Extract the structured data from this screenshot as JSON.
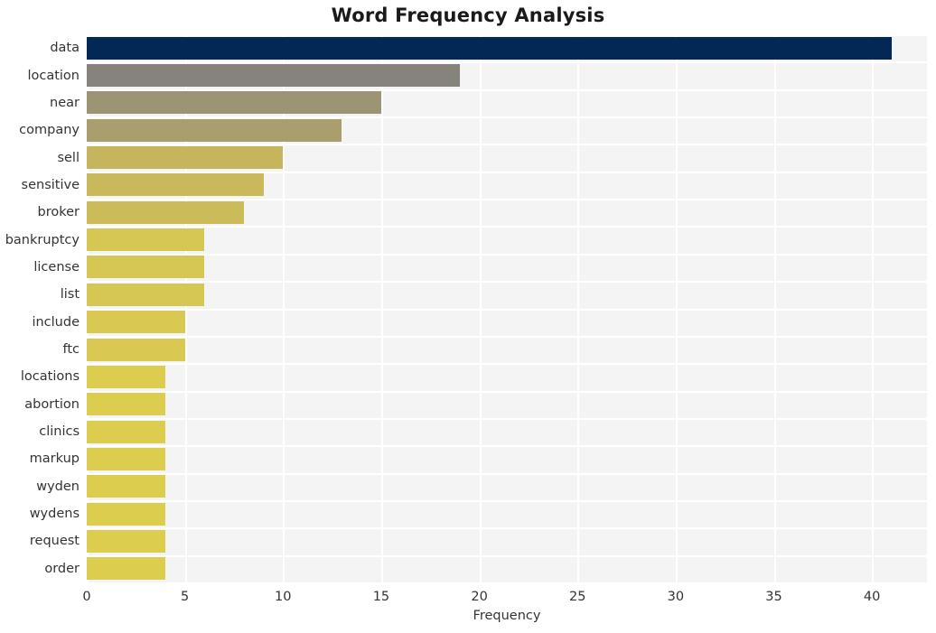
{
  "chart_data": {
    "type": "bar",
    "orientation": "horizontal",
    "title": "Word Frequency Analysis",
    "xlabel": "Frequency",
    "ylabel": "",
    "categories": [
      "data",
      "location",
      "near",
      "company",
      "sell",
      "sensitive",
      "broker",
      "bankruptcy",
      "license",
      "list",
      "include",
      "ftc",
      "locations",
      "abortion",
      "clinics",
      "markup",
      "wyden",
      "wydens",
      "request",
      "order"
    ],
    "values": [
      41,
      19,
      15,
      13,
      10,
      9,
      8,
      6,
      6,
      6,
      5,
      5,
      4,
      4,
      4,
      4,
      4,
      4,
      4,
      4
    ],
    "bar_colors": [
      "#042855",
      "#85837b",
      "#9d9473",
      "#a99e6d",
      "#c5b65d",
      "#c9b95b",
      "#cbbc59",
      "#d6c654",
      "#d6c654",
      "#d6c654",
      "#d9c952",
      "#d9c952",
      "#dccd4f",
      "#dccd4f",
      "#dccd4f",
      "#dccd4f",
      "#dccd4f",
      "#dccd4f",
      "#dccd4f",
      "#dccd4f"
    ],
    "xlim": [
      0,
      42.8
    ],
    "x_ticks": [
      0,
      5,
      10,
      15,
      20,
      25,
      30,
      35,
      40
    ],
    "x_tick_labels": [
      "0",
      "5",
      "10",
      "15",
      "20",
      "25",
      "30",
      "35",
      "40"
    ],
    "grid": true,
    "grid_color": "#ffffff",
    "plot_background": "#f4f4f4",
    "figure_background": "#ffffff",
    "legend": null,
    "legend_position": "none"
  }
}
